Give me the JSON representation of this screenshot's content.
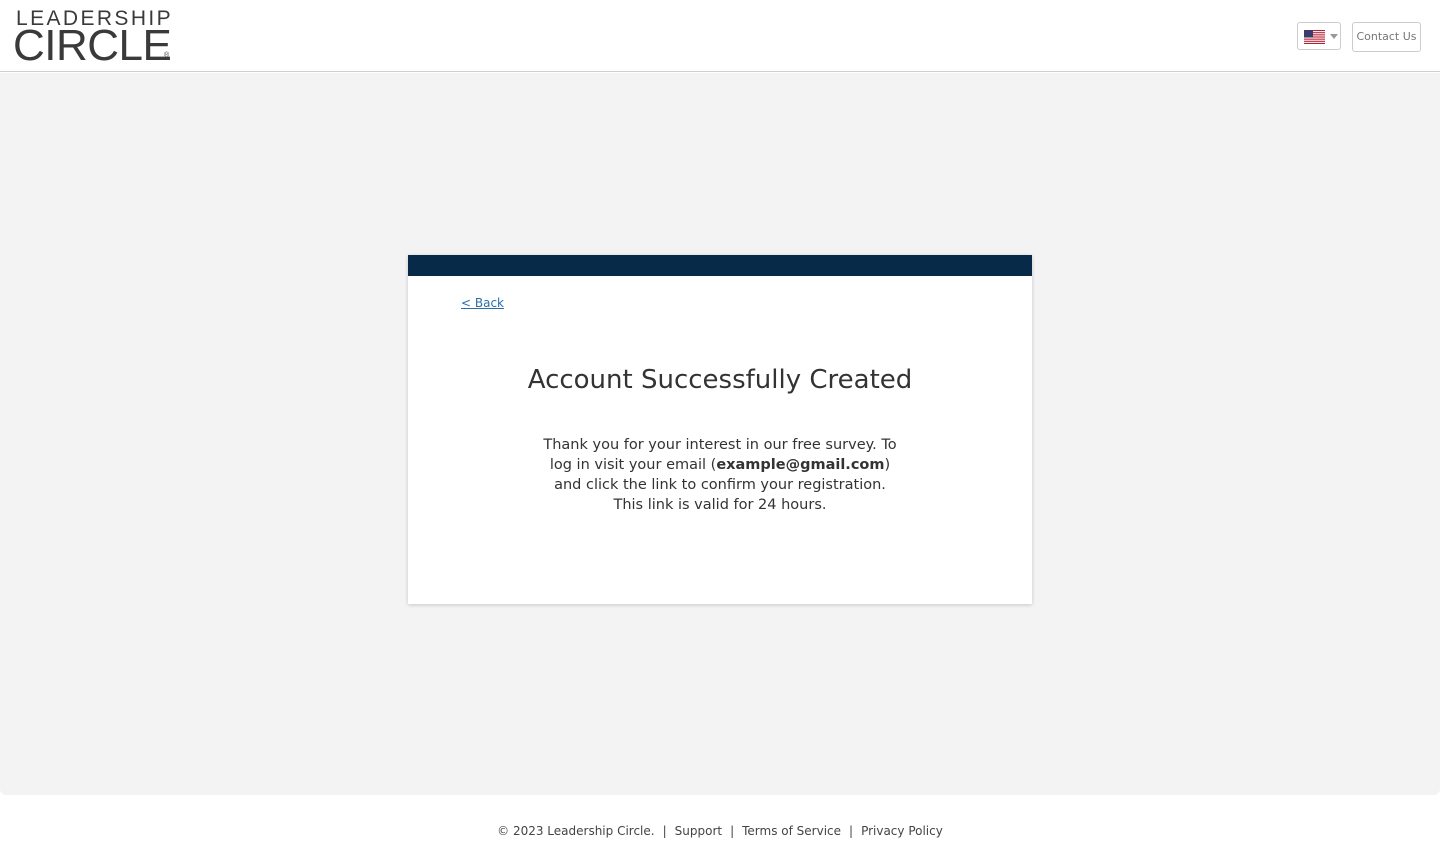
{
  "header": {
    "logo_top": "LEADERSHIP",
    "logo_bottom": "CIRCLE",
    "logo_reg": "®",
    "language_flag": "us-flag-icon",
    "contact_label": "Contact Us"
  },
  "card": {
    "accent_color": "#072a48",
    "back_label": "< Back",
    "title": "Account Successfully Created",
    "body_before": "Thank you for your interest in our free survey. To log in visit your email (",
    "email": "example@gmail.com",
    "body_after": ") and click the link to confirm your registration. This link is valid for 24 hours."
  },
  "footer": {
    "copyright": "© 2023 Leadership Circle.",
    "separator": "|",
    "support": "Support",
    "terms": "Terms of Service",
    "privacy": "Privacy Policy"
  }
}
